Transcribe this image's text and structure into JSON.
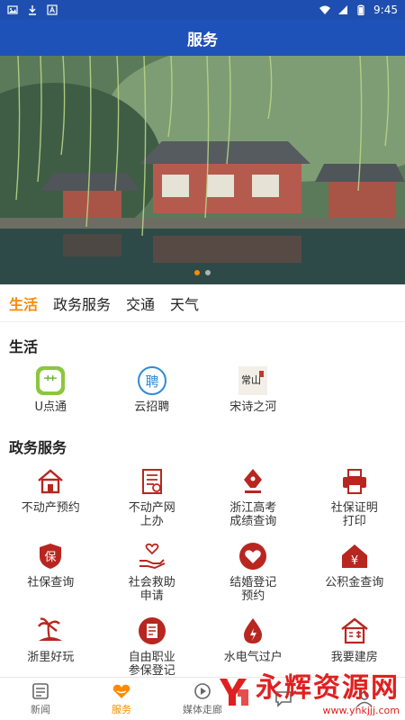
{
  "statusbar": {
    "time": "9:45"
  },
  "header": {
    "title": "服务"
  },
  "tabs": [
    {
      "label": "生活",
      "active": true
    },
    {
      "label": "政务服务",
      "active": false
    },
    {
      "label": "交通",
      "active": false
    },
    {
      "label": "天气",
      "active": false
    }
  ],
  "life": {
    "title": "生活",
    "items": [
      {
        "label": "U点通",
        "icon": "u-diantong-icon"
      },
      {
        "label": "云招聘",
        "icon": "recruit-icon",
        "glyph": "聘"
      },
      {
        "label": "宋诗之河",
        "icon": "song-poem-icon",
        "glyph": "常山"
      }
    ]
  },
  "gov": {
    "title": "政务服务",
    "items": [
      {
        "label": "不动产预约",
        "icon": "house-icon"
      },
      {
        "label": "不动产网\n上办",
        "icon": "document-icon"
      },
      {
        "label": "浙江高考\n成绩查询",
        "icon": "pen-nib-icon"
      },
      {
        "label": "社保证明\n打印",
        "icon": "printer-icon"
      },
      {
        "label": "社保查询",
        "icon": "shield-icon",
        "glyph": "保"
      },
      {
        "label": "社会救助\n申请",
        "icon": "hand-heart-icon"
      },
      {
        "label": "结婚登记\n预约",
        "icon": "heart-icon"
      },
      {
        "label": "公积金查询",
        "icon": "yuan-house-icon"
      },
      {
        "label": "浙里好玩",
        "icon": "palm-tree-icon"
      },
      {
        "label": "自由职业\n参保登记",
        "icon": "form-icon"
      },
      {
        "label": "水电气过户",
        "icon": "utility-drop-icon"
      },
      {
        "label": "我要建房",
        "icon": "build-house-icon"
      }
    ]
  },
  "bottomnav": [
    {
      "label": "新闻",
      "icon": "news-icon",
      "active": false
    },
    {
      "label": "服务",
      "icon": "service-icon",
      "active": true
    },
    {
      "label": "媒体走廊",
      "icon": "media-icon",
      "active": false
    },
    {
      "label": "",
      "icon": "chat-icon",
      "active": false
    },
    {
      "label": "",
      "icon": "user-icon",
      "active": false
    }
  ],
  "watermark": {
    "text": "永辉资源网",
    "url": "www.yhkjjj.com"
  },
  "colors": {
    "primary_blue": "#1f52b8",
    "accent_orange": "#ff8a00",
    "icon_red": "#b8261f"
  }
}
